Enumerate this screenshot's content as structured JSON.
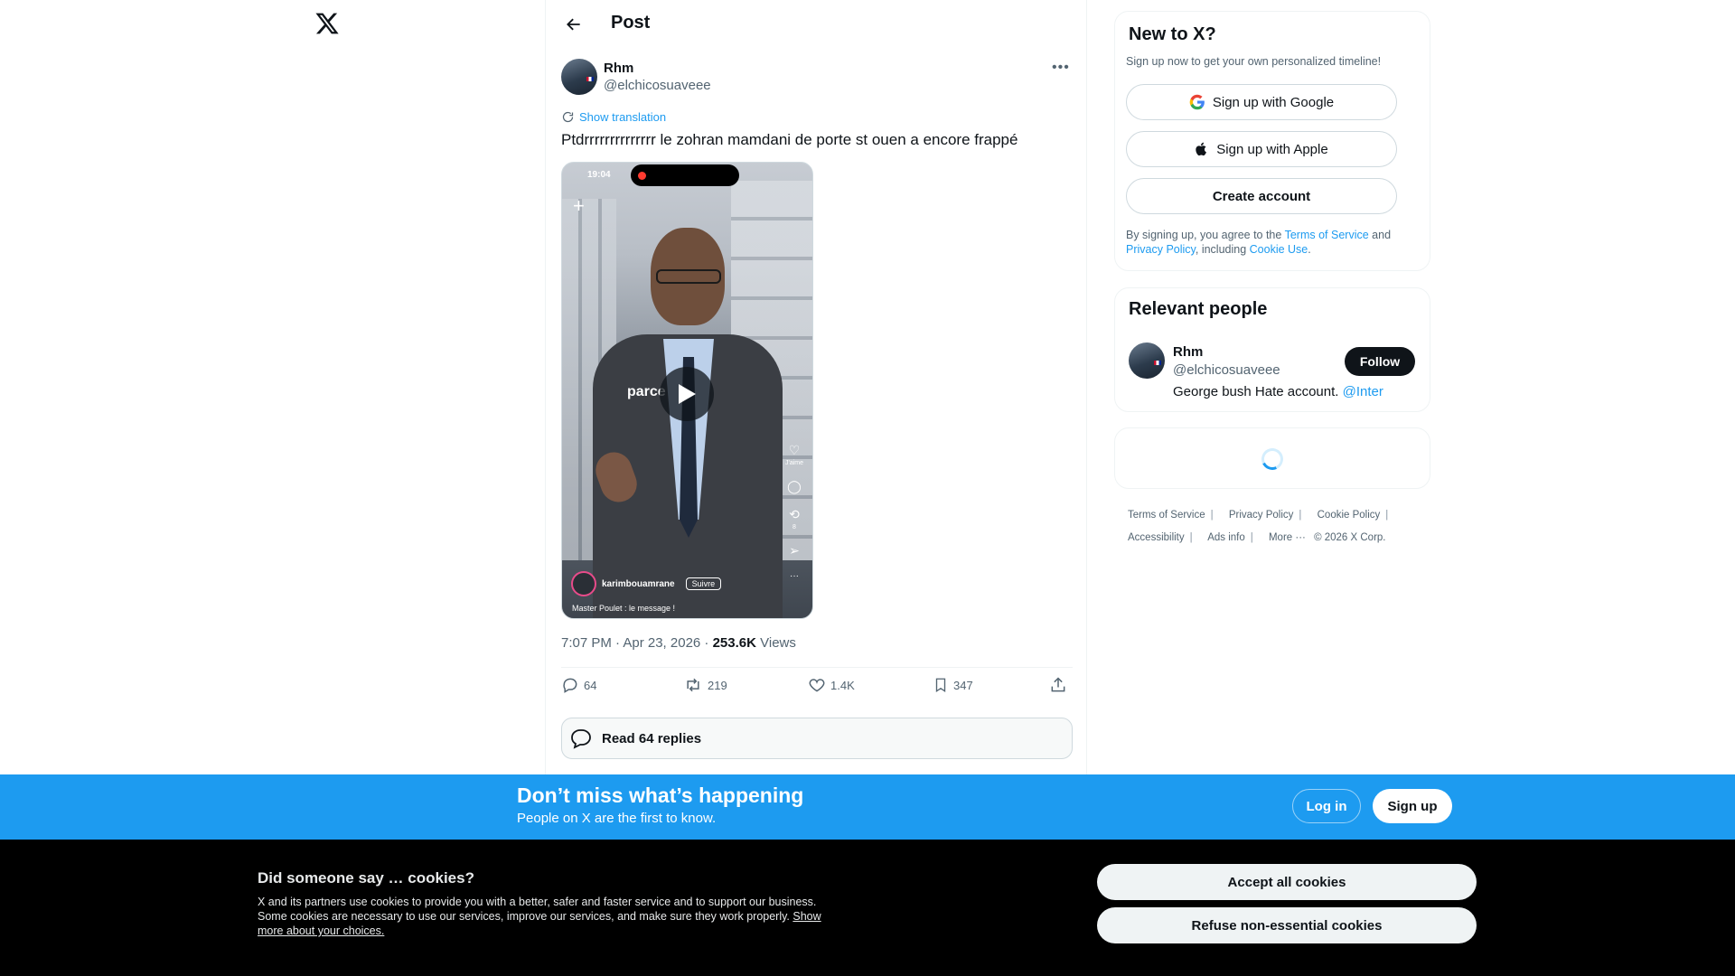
{
  "nav": {
    "logo_glyph": "𝕏"
  },
  "header": {
    "title": "Post",
    "back_icon": "arrow-left-icon"
  },
  "post": {
    "author_name": "Rhm",
    "author_handle": "@elchicosuaveee",
    "more_glyph": "•••",
    "translation_label": "Show translation",
    "text": "Ptdrrrrrrrrrrrrrr le zohran mamdani de porte st ouen a encore frappé",
    "media": {
      "status_time": "19:04",
      "overlay_word": "parce",
      "side_like_label": "J'aime",
      "side_repost_count": "8",
      "tiktok_user": "karimbouamrane",
      "tiktok_follow": "Suivre",
      "tiktok_caption": "Master Poulet : le message !"
    },
    "timestamp": "7:07 PM · Apr 23, 2026 · ",
    "views_count": "253.6K",
    "views_label": " Views",
    "stats": {
      "replies": "64",
      "reposts": "219",
      "likes": "1.4K",
      "bookmarks": "347"
    },
    "read_replies_label": "Read 64 replies"
  },
  "new_to_x": {
    "title": "New to X?",
    "subtitle": "Sign up now to get your own personalized timeline!",
    "google_label": "Sign up with Google",
    "apple_label": "Sign up with Apple",
    "create_label": "Create account",
    "terms_prefix": "By signing up, you agree to the ",
    "terms_link": "Terms of Service",
    "terms_and": " and ",
    "privacy_link": "Privacy Policy",
    "terms_including": ", including ",
    "cookie_link": "Cookie Use",
    "terms_end": "."
  },
  "relevant_people": {
    "title": "Relevant people",
    "name": "Rhm",
    "handle": "@elchicosuaveee",
    "bio": "George bush Hate account. ",
    "bio_mention": "@Inter",
    "follow_label": "Follow"
  },
  "footer": {
    "links": [
      "Terms of Service",
      "Privacy Policy",
      "Cookie Policy",
      "Accessibility",
      "Ads info",
      "More ···",
      "© 2026 X Corp."
    ]
  },
  "banner": {
    "title": "Don’t miss what’s happening",
    "subtitle": "People on X are the first to know.",
    "login_label": "Log in",
    "signup_label": "Sign up"
  },
  "cookies": {
    "title": "Did someone say … cookies?",
    "body": "X and its partners use cookies to provide you with a better, safer and faster service and to support our business. Some cookies are necessary to use our services, improve our services, and make sure they work properly. ",
    "choices_link": "Show more about your choices.",
    "accept_label": "Accept all cookies",
    "refuse_label": "Refuse non-essential cookies"
  },
  "colors": {
    "accent": "#1d9bf0",
    "text": "#0f1419",
    "muted": "#536471",
    "banner": "#1d9bf0"
  }
}
